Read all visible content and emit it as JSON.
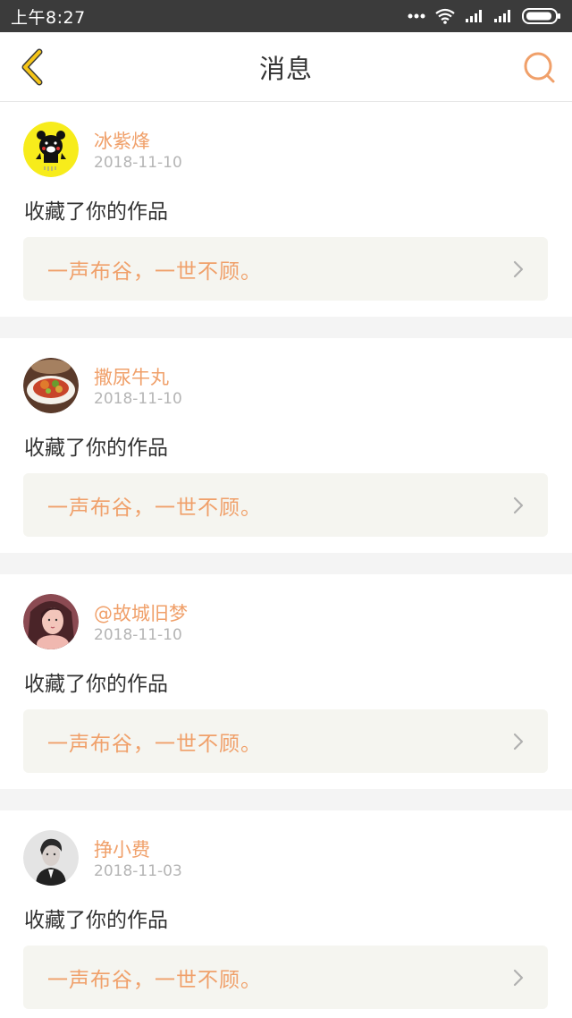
{
  "status_bar": {
    "time": "上午8:27",
    "icons": [
      "more-dots-icon",
      "wifi-icon",
      "signal-icon",
      "signal-icon",
      "battery-icon"
    ]
  },
  "header": {
    "title": "消息",
    "back_icon": "chevron-left-icon",
    "search_icon": "search-icon"
  },
  "colors": {
    "accent": "#f0a06a",
    "back_icon": "#f5c518",
    "separator": "#f4f4f4",
    "work_box_bg": "#f5f5f0"
  },
  "messages": [
    {
      "username": "冰紫烽",
      "date": "2018-11-10",
      "action": "收藏了你的作品",
      "work_title": "一声布谷，一世不顾。",
      "avatar": "bear-avatar"
    },
    {
      "username": "撒尿牛丸",
      "date": "2018-11-10",
      "action": "收藏了你的作品",
      "work_title": "一声布谷，一世不顾。",
      "avatar": "food-avatar"
    },
    {
      "username": "@故城旧梦",
      "date": "2018-11-10",
      "action": "收藏了你的作品",
      "work_title": "一声布谷，一世不顾。",
      "avatar": "girl-avatar"
    },
    {
      "username": "挣小费",
      "date": "2018-11-03",
      "action": "收藏了你的作品",
      "work_title": "一声布谷，一世不顾。",
      "avatar": "man-avatar"
    }
  ]
}
